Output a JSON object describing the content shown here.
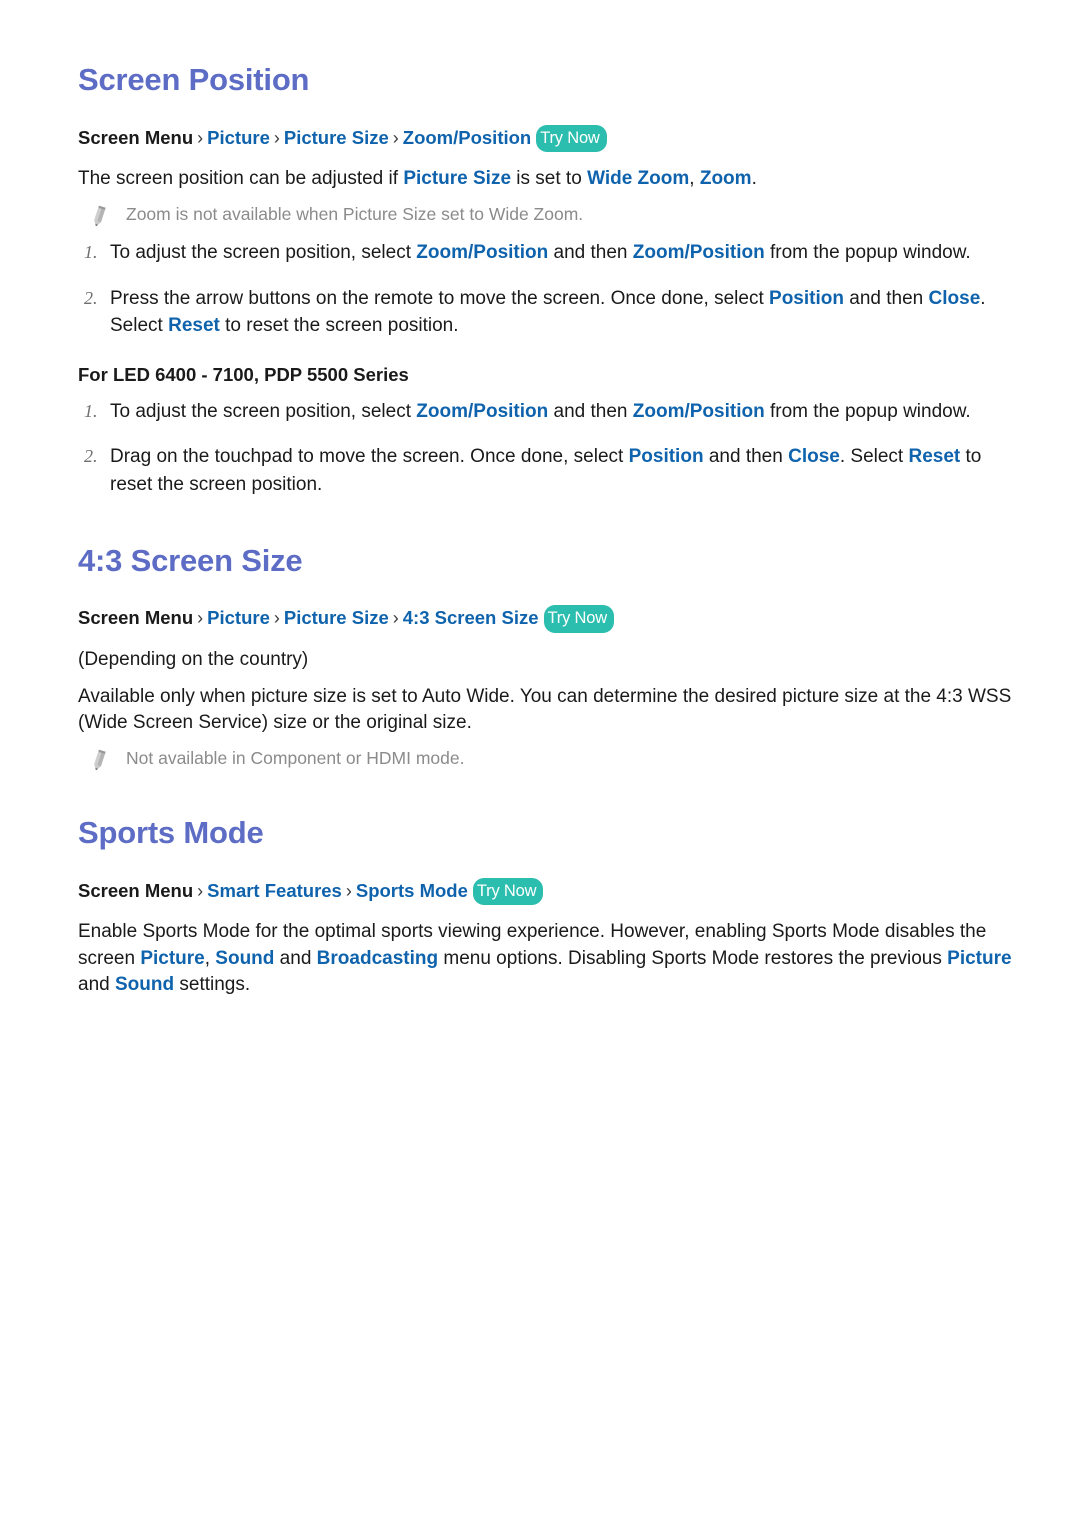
{
  "page": {
    "accent_heading_color": "#5d6cc4",
    "link_color": "#0f63ad",
    "badge_color": "#2bbdae",
    "note_color": "#8b8b8b",
    "body_color": "#1a1a1a"
  },
  "sections": [
    {
      "title": "Screen Position",
      "breadcrumb": {
        "root": "Screen Menu",
        "sep": "›",
        "links": [
          "Picture",
          "Picture Size",
          "Zoom/Position"
        ],
        "badge": "Try Now"
      },
      "intro": {
        "part1": "The screen position can be adjusted if ",
        "kw1": "Picture Size",
        "part2": " is set to ",
        "kw2": "Wide Zoom",
        "part3": ", ",
        "kw3": "Zoom",
        "part4": "."
      },
      "note": "Zoom is not available when Picture Size set to Wide Zoom.",
      "steps": [
        {
          "num": "1.",
          "part1": "To adjust the screen position, select ",
          "kw1": "Zoom/Position",
          "part2": " and then ",
          "kw2": "Zoom/Position",
          "part3": " from the popup window."
        },
        {
          "num": "2.",
          "part1": "Press the arrow buttons on the remote to move the screen. Once done, select ",
          "kw1": "Position",
          "part2": " and then ",
          "kw2": "Close",
          "part3": ". Select ",
          "kw3": "Reset",
          "part4": " to reset the screen position."
        }
      ],
      "sub_heading": "For LED 6400 - 7100, PDP 5500 Series",
      "steps2": [
        {
          "num": "1.",
          "part1": "To adjust the screen position, select ",
          "kw1": "Zoom/Position",
          "part2": " and then ",
          "kw2": "Zoom/Position",
          "part3": " from the popup window."
        },
        {
          "num": "2.",
          "part1": "Drag on the touchpad to move the screen. Once done, select ",
          "kw1": "Position",
          "part2": " and then ",
          "kw2": "Close",
          "part3": ". Select ",
          "kw3": "Reset",
          "part4": " to reset the screen position."
        }
      ]
    },
    {
      "title": "4:3 Screen Size",
      "breadcrumb": {
        "root": "Screen Menu",
        "sep": "›",
        "links": [
          "Picture",
          "Picture Size",
          "4:3 Screen Size"
        ],
        "badge": "Try Now"
      },
      "depending": "(Depending on the country)",
      "paragraph": "Available only when picture size is set to Auto Wide. You can determine the desired picture size at the 4:3 WSS (Wide Screen Service) size or the original size.",
      "note": "Not available in Component or HDMI mode."
    },
    {
      "title": "Sports Mode",
      "breadcrumb": {
        "root": "Screen Menu",
        "sep": "›",
        "links": [
          "Smart Features",
          "Sports Mode"
        ],
        "badge": "Try Now"
      },
      "paragraph": {
        "part1": "Enable Sports Mode for the optimal sports viewing experience. However, enabling Sports Mode disables the screen ",
        "kw1": "Picture",
        "part2": ", ",
        "kw2": "Sound",
        "part3": " and ",
        "kw3": "Broadcasting",
        "part4": " menu options. Disabling Sports Mode restores the previous ",
        "kw4": "Picture",
        "part5": " and ",
        "kw5": "Sound",
        "part6": " settings."
      }
    }
  ]
}
